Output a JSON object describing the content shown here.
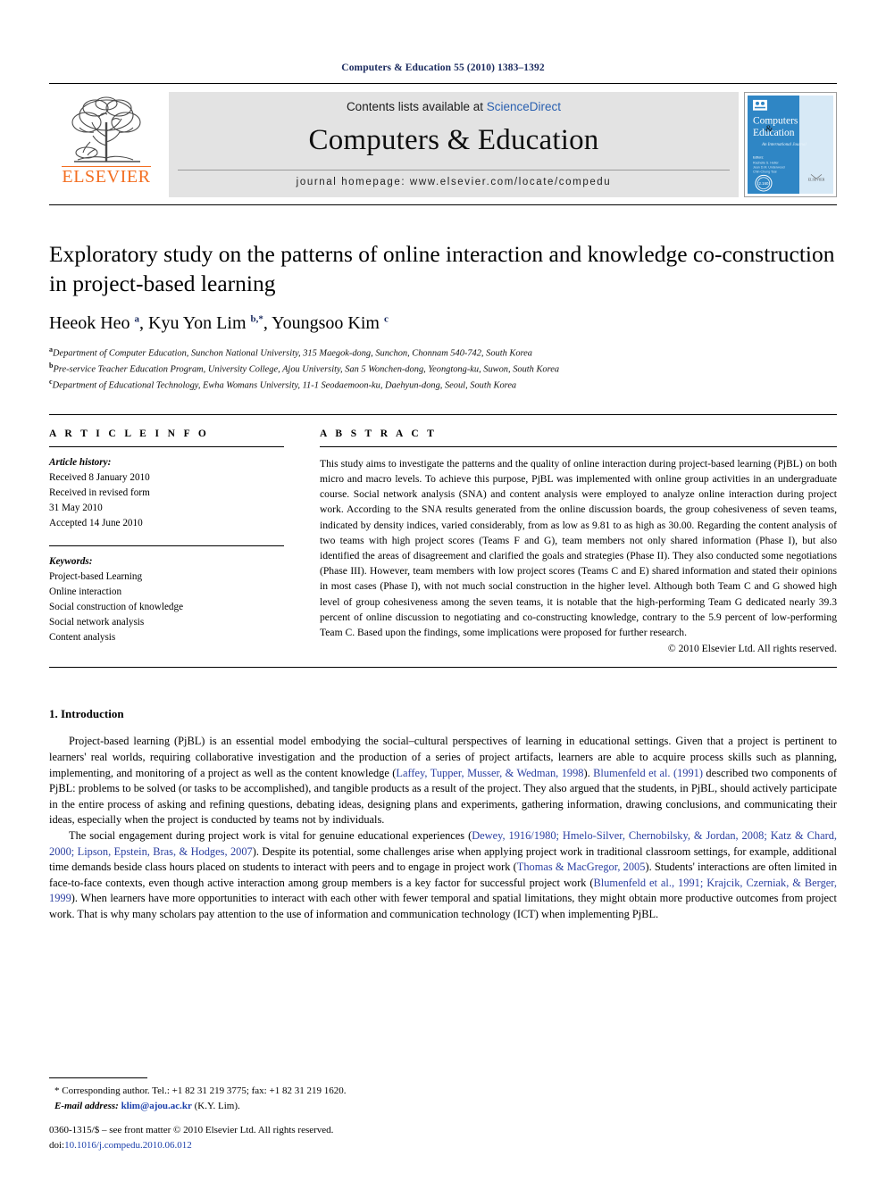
{
  "running_head": "Computers & Education 55 (2010) 1383–1392",
  "masthead": {
    "publisher_name": "ELSEVIER",
    "contents_prefix": "Contents lists available at ",
    "contents_link": "ScienceDirect",
    "journal_title": "Computers & Education",
    "homepage": "journal homepage: www.elsevier.com/locate/compedu",
    "cover": {
      "line1": "Computers",
      "amp": "&",
      "line2": "Education",
      "subtitle": "An International Journal",
      "editors_label": "Editors:",
      "editor1": "Rachelle S. Heller",
      "editor2": "Jean D.M. Underwood",
      "editor3": "Chin-Chung Tsai",
      "badge": "2.160",
      "publisher": "ELSEVIER"
    }
  },
  "article": {
    "title": "Exploratory study on the patterns of online interaction and knowledge co-construction in project-based learning",
    "authors_html": "Heeok Heo <sup>a</sup>, Kyu Yon Lim <sup>b,</sup><sup>*</sup>, Youngsoo Kim <sup>c</sup>",
    "affiliations": [
      {
        "mark": "a",
        "text": "Department of Computer Education, Sunchon National University, 315 Maegok-dong, Sunchon, Chonnam 540-742, South Korea"
      },
      {
        "mark": "b",
        "text": "Pre-service Teacher Education Program, University College, Ajou University, San 5 Wonchen-dong, Yeongtong-ku, Suwon, South Korea"
      },
      {
        "mark": "c",
        "text": "Department of Educational Technology, Ewha Womans University, 11-1 Seodaemoon-ku, Daehyun-dong, Seoul, South Korea"
      }
    ]
  },
  "article_info": {
    "heading": "A R T I C L E  I N F O",
    "history_label": "Article history:",
    "history": [
      "Received 8 January 2010",
      "Received in revised form",
      "31 May 2010",
      "Accepted 14 June 2010"
    ],
    "keywords_label": "Keywords:",
    "keywords": [
      "Project-based Learning",
      "Online interaction",
      "Social construction of knowledge",
      "Social network analysis",
      "Content analysis"
    ]
  },
  "abstract": {
    "heading": "A B S T R A C T",
    "text": "This study aims to investigate the patterns and the quality of online interaction during project-based learning (PjBL) on both micro and macro levels. To achieve this purpose, PjBL was implemented with online group activities in an undergraduate course. Social network analysis (SNA) and content analysis were employed to analyze online interaction during project work. According to the SNA results generated from the online discussion boards, the group cohesiveness of seven teams, indicated by density indices, varied considerably, from as low as 9.81 to as high as 30.00. Regarding the content analysis of two teams with high project scores (Teams F and G), team members not only shared information (Phase I), but also identified the areas of disagreement and clarified the goals and strategies (Phase II). They also conducted some negotiations (Phase III). However, team members with low project scores (Teams C and E) shared information and stated their opinions in most cases (Phase I), with not much social construction in the higher level. Although both Team C and G showed high level of group cohesiveness among the seven teams, it is notable that the high-performing Team G dedicated nearly 39.3 percent of online discussion to negotiating and co-constructing knowledge, contrary to the 5.9 percent of low-performing Team C. Based upon the findings, some implications were proposed for further research.",
    "copyright": "© 2010 Elsevier Ltd. All rights reserved."
  },
  "introduction": {
    "number_title": "1.  Introduction",
    "paragraph1_parts": [
      {
        "t": "Project-based learning (PjBL) is an essential model embodying the social–cultural perspectives of learning in educational settings. Given that a project is pertinent to learners' real worlds, requiring collaborative investigation and the production of a series of project artifacts, learners are able to acquire process skills such as planning, implementing, and monitoring of a project as well as the content knowledge (",
        "c": false
      },
      {
        "t": "Laffey, Tupper, Musser, & Wedman, 1998",
        "c": true
      },
      {
        "t": "). ",
        "c": false
      },
      {
        "t": "Blumenfeld et al. (1991)",
        "c": true
      },
      {
        "t": " described two components of PjBL: problems to be solved (or tasks to be accomplished), and tangible products as a result of the project. They also argued that the students, in PjBL, should actively participate in the entire process of asking and refining questions, debating ideas, designing plans and experiments, gathering information, drawing conclusions, and communicating their ideas, especially when the project is conducted by teams not by individuals.",
        "c": false
      }
    ],
    "paragraph2_parts": [
      {
        "t": "The social engagement during project work is vital for genuine educational experiences (",
        "c": false
      },
      {
        "t": "Dewey, 1916/1980; Hmelo-Silver, Chernobilsky, & Jordan, 2008; Katz & Chard, 2000; Lipson, Epstein, Bras, & Hodges, 2007",
        "c": true
      },
      {
        "t": "). Despite its potential, some challenges arise when applying project work in traditional classroom settings, for example, additional time demands beside class hours placed on students to interact with peers and to engage in project work (",
        "c": false
      },
      {
        "t": "Thomas & MacGregor, 2005",
        "c": true
      },
      {
        "t": "). Students' interactions are often limited in face-to-face contexts, even though active interaction among group members is a key factor for successful project work (",
        "c": false
      },
      {
        "t": "Blumenfeld et al., 1991; Krajcik, Czerniak, & Berger, 1999",
        "c": true
      },
      {
        "t": "). When learners have more opportunities to interact with each other with fewer temporal and spatial limitations, they might obtain more productive outcomes from project work. That is why many scholars pay attention to the use of information and communication technology (ICT) when implementing PjBL.",
        "c": false
      }
    ]
  },
  "footnotes": {
    "corresponding": "*  Corresponding author. Tel.: +1 82 31 219 3775; fax: +1 82 31 219 1620.",
    "email_label": "E-mail address:",
    "email": "klim@ajou.ac.kr",
    "email_suffix": "(K.Y. Lim)."
  },
  "footer": {
    "front_matter": "0360-1315/$ – see front matter © 2010 Elsevier Ltd. All rights reserved.",
    "doi_label": "doi:",
    "doi": "10.1016/j.compedu.2010.06.012"
  }
}
